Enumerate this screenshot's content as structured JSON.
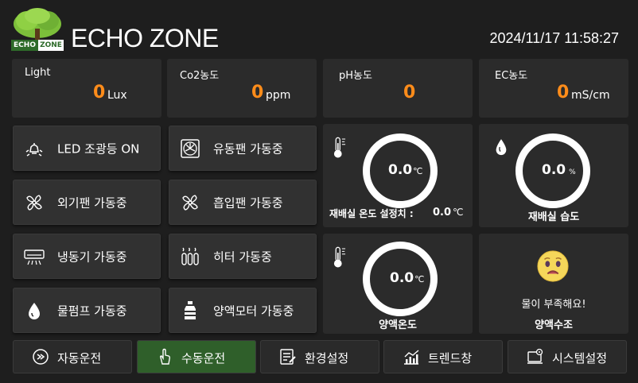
{
  "header": {
    "logo_text_left": "ECHO",
    "logo_text_right": "ZONE",
    "title": "ECHO ZONE",
    "datetime": "2024/11/17 11:58:27"
  },
  "sensors": [
    {
      "label": "Light",
      "value": "0",
      "unit": "Lux"
    },
    {
      "label": "Co2농도",
      "value": "0",
      "unit": "ppm"
    },
    {
      "label": "pH농도",
      "value": "0",
      "unit": ""
    },
    {
      "label": "EC농도",
      "value": "0",
      "unit": "mS/cm"
    }
  ],
  "controls": [
    {
      "label": "LED 조광등  ON",
      "icon": "bulb-icon"
    },
    {
      "label": "유동팬 가동중",
      "icon": "fan-box-icon"
    },
    {
      "label": "외기팬 가동중",
      "icon": "fan-icon"
    },
    {
      "label": "흡입팬 가동중",
      "icon": "fan-icon"
    },
    {
      "label": "냉동기 가동중",
      "icon": "air-conditioner-icon"
    },
    {
      "label": "히터 가동중",
      "icon": "heater-icon"
    },
    {
      "label": "물펌프 가동중",
      "icon": "water-drop-icon"
    },
    {
      "label": "양액모터 가동중",
      "icon": "bottle-icon"
    }
  ],
  "gauges": {
    "room_temp": {
      "value": "0.0",
      "unit": "℃",
      "setpoint_label": "재배실 온도 설정치 :",
      "setpoint_value": "0.0",
      "setpoint_unit": "℃"
    },
    "room_humidity": {
      "value": "0.0",
      "unit": "%",
      "caption": "재배실 습도"
    },
    "nutrient_temp": {
      "value": "0.0",
      "unit": "℃",
      "caption": "양액온도"
    },
    "water_tank": {
      "message": "물이 부족해요!",
      "caption": "양액수조"
    }
  },
  "nav": [
    {
      "label": "자동운전",
      "icon": "auto-icon",
      "active": false
    },
    {
      "label": "수동운전",
      "icon": "hand-pointer-icon",
      "active": true
    },
    {
      "label": "환경설정",
      "icon": "settings-list-icon",
      "active": false
    },
    {
      "label": "트렌드창",
      "icon": "trend-chart-icon",
      "active": false
    },
    {
      "label": "시스템설정",
      "icon": "system-settings-icon",
      "active": false
    }
  ],
  "colors": {
    "accent_value": "#ff8c1a",
    "active_nav": "#2f5f2a",
    "panel": "#2b2b2b",
    "background": "#1e1e1e"
  }
}
